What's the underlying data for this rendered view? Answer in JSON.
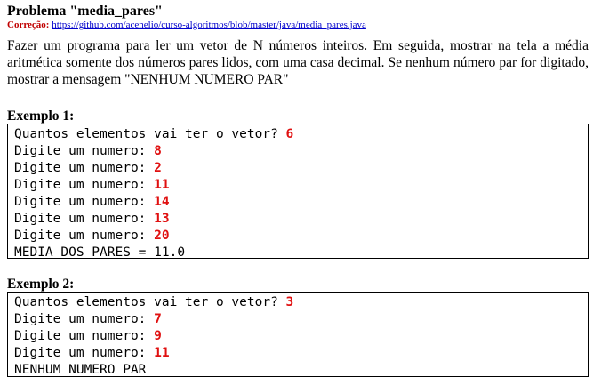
{
  "problem": {
    "title": "Problema \"media_pares\"",
    "correction_label": "Correção:",
    "correction_link": "https://github.com/acenelio/curso-algoritmos/blob/master/java/media_pares.java",
    "description": "Fazer um programa para ler um vetor de N números inteiros. Em seguida, mostrar na tela a média aritmética somente dos números pares lidos, com uma casa decimal. Se nenhum número par for digitado, mostrar a mensagem \"NENHUM NUMERO PAR\""
  },
  "examples": [
    {
      "title": "Exemplo 1:",
      "lines": [
        {
          "prompt": "Quantos elementos vai ter o vetor? ",
          "input": "6"
        },
        {
          "prompt": "Digite um numero: ",
          "input": "8"
        },
        {
          "prompt": "Digite um numero: ",
          "input": "2"
        },
        {
          "prompt": "Digite um numero: ",
          "input": "11"
        },
        {
          "prompt": "Digite um numero: ",
          "input": "14"
        },
        {
          "prompt": "Digite um numero: ",
          "input": "13"
        },
        {
          "prompt": "Digite um numero: ",
          "input": "20"
        },
        {
          "prompt": "MEDIA DOS PARES = 11.0",
          "input": ""
        }
      ]
    },
    {
      "title": "Exemplo 2:",
      "lines": [
        {
          "prompt": "Quantos elementos vai ter o vetor? ",
          "input": "3"
        },
        {
          "prompt": "Digite um numero: ",
          "input": "7"
        },
        {
          "prompt": "Digite um numero: ",
          "input": "9"
        },
        {
          "prompt": "Digite um numero: ",
          "input": "11"
        },
        {
          "prompt": "NENHUM NUMERO PAR",
          "input": ""
        }
      ]
    }
  ]
}
